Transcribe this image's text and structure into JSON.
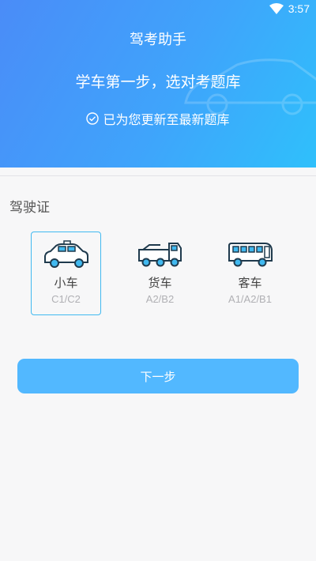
{
  "status_bar": {
    "time": "3:57",
    "wifi_icon": "wifi-icon"
  },
  "header": {
    "app_title": "驾考助手",
    "slogan": "学车第一步，选对考题库",
    "update_note": "已为您更新至最新题库",
    "check_icon": "check-circle-icon",
    "gradient_colors": [
      "#4a8cf8",
      "#3fa4fb",
      "#2fc0fb"
    ]
  },
  "license_section": {
    "label": "驾驶证",
    "options": [
      {
        "name": "小车",
        "sub": "C1/C2",
        "icon": "car-icon",
        "selected": true
      },
      {
        "name": "货车",
        "sub": "A2/B2",
        "icon": "truck-icon",
        "selected": false
      },
      {
        "name": "客车",
        "sub": "A1/A2/B1",
        "icon": "bus-icon",
        "selected": false
      }
    ]
  },
  "next_button": {
    "label": "下一步",
    "color": "#52b8ff"
  },
  "colors": {
    "accent": "#41b9f0",
    "icon_stroke": "#1f3a4d"
  }
}
